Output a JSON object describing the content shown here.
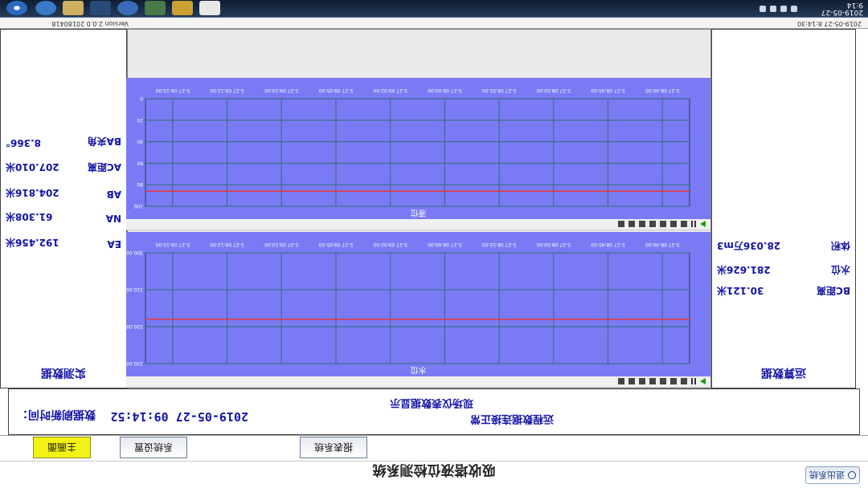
{
  "app": {
    "title": "吸收塔液位检测系统",
    "exit_label": "退出系统"
  },
  "nav": {
    "tabs": [
      {
        "label": "主画面",
        "active": true
      },
      {
        "label": "系统设置",
        "active": false
      },
      {
        "label": "报表系统",
        "active": false
      }
    ]
  },
  "status": {
    "update_time_label": "数据刷新时间：",
    "update_time_value": "2019-05-27 09:14:52",
    "remote_status": "远程数据连接正常",
    "local_status": "现场仪表数据显示"
  },
  "measure_panel": {
    "header": "实测数据",
    "rows": [
      {
        "key": "BA夹角",
        "value": "8.366°"
      },
      {
        "key": "AC距离",
        "value": "207.010米"
      },
      {
        "key": "AB",
        "value": "204.816米"
      },
      {
        "key": "NA",
        "value": "61.308米"
      },
      {
        "key": "EA",
        "value": "192.456米"
      }
    ]
  },
  "calc_panel": {
    "header": "运算数据",
    "rows": [
      {
        "key": "体积",
        "value": "28.036万m3"
      },
      {
        "key": "水位",
        "value": "281.626米"
      },
      {
        "key": "BC距离",
        "value": "30.121米"
      }
    ]
  },
  "charts": [
    {
      "name": "液位",
      "time_labels": [
        "5-27 08:40:00",
        "5-27 08:45:00",
        "5-27 08:50:00",
        "5-27 08:55:00",
        "5-27 09:00:00",
        "5-27 09:02:00",
        "5-27 09:05:00",
        "5-27 09:10:00",
        "5-27 09:12:00",
        "5-27 09:15:00"
      ],
      "y_labels": [
        "0",
        "20",
        "40",
        "60",
        "80",
        "100"
      ],
      "line_value": 86
    },
    {
      "name": "水位",
      "time_labels": [
        "5-27 08:40:00",
        "5-27 08:45:00",
        "5-27 08:50:00",
        "5-27 08:55:00",
        "5-27 09:00:00",
        "5-27 09:02:00",
        "5-27 09:05:00",
        "5-27 09:10:00",
        "5-27 09:12:00",
        "5-27 09:15:00"
      ],
      "y_labels": [
        "300.000",
        "310.000",
        "320.000",
        "330.000"
      ],
      "line_value": 318
    }
  ],
  "taskbar": {
    "clock": "2019-05-27",
    "clock_time": "9:14",
    "window_label": "吸收塔液位检测系统"
  },
  "top_strip": {
    "version": "Version 2.0.0 20180418",
    "date": "2019-05-27 8:14:30"
  },
  "colors": {
    "chart_bg": "#7a7af5",
    "chart_line": "#e83a3a",
    "text_blue": "#1414a8"
  }
}
